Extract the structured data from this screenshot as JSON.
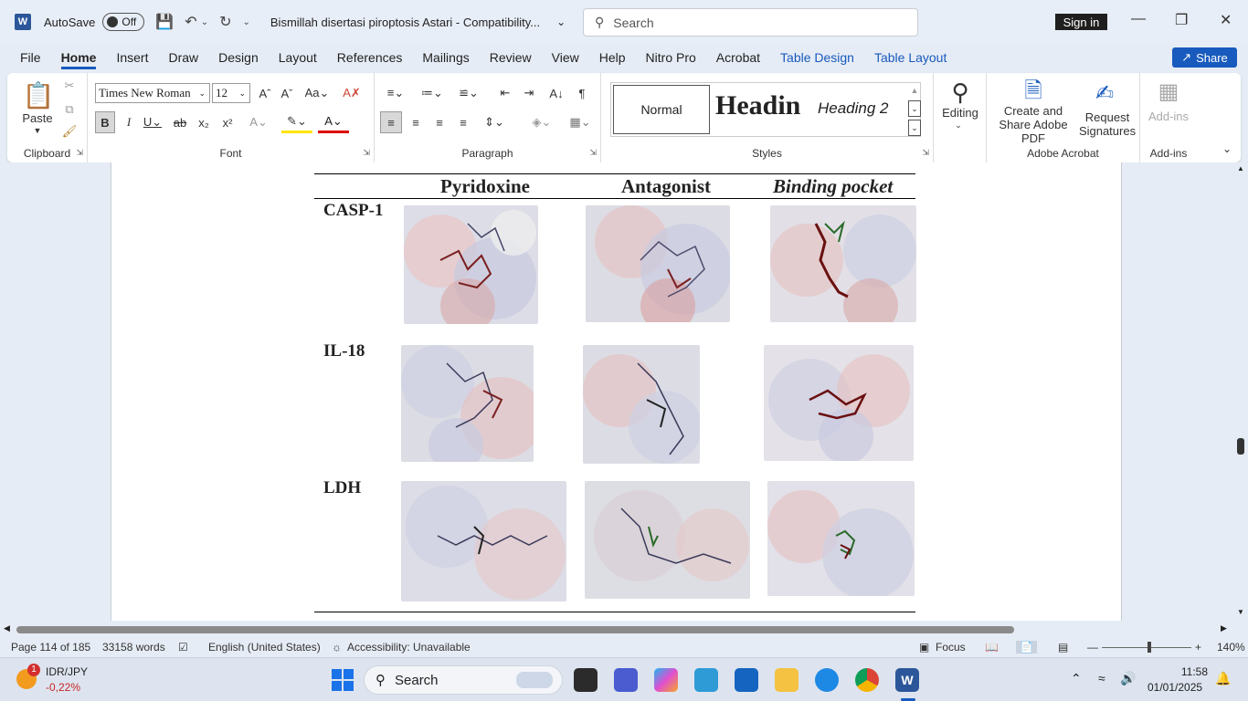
{
  "titlebar": {
    "autosave_label": "AutoSave",
    "autosave_state": "Off",
    "doc_title": "Bismillah disertasi piroptosis Astari  -  Compatibility...",
    "search_placeholder": "Search",
    "signin_label": "Sign in"
  },
  "menu": {
    "tabs": [
      "File",
      "Home",
      "Insert",
      "Draw",
      "Design",
      "Layout",
      "References",
      "Mailings",
      "Review",
      "View",
      "Help",
      "Nitro Pro",
      "Acrobat",
      "Table Design",
      "Table Layout"
    ],
    "share_label": "Share"
  },
  "ribbon": {
    "clipboard": {
      "paste_label": "Paste",
      "group_label": "Clipboard"
    },
    "font": {
      "font_name": "Times New Roman",
      "font_size": "12",
      "group_label": "Font"
    },
    "paragraph": {
      "group_label": "Paragraph"
    },
    "styles": {
      "normal": "Normal",
      "heading1": "Headin",
      "heading2": "Heading 2",
      "group_label": "Styles"
    },
    "editing": {
      "label": "Editing"
    },
    "acrobat": {
      "create_share": "Create and Share Adobe PDF",
      "request_signatures": "Request Signatures",
      "group_label": "Adobe Acrobat"
    },
    "addins": {
      "label": "Add-ins",
      "group_label": "Add-ins"
    }
  },
  "document": {
    "columns": [
      "Pyridoxine",
      "Antagonist",
      "Binding pocket"
    ],
    "rows": [
      "CASP-1",
      "IL-18",
      "LDH"
    ]
  },
  "statusbar": {
    "page": "Page 114 of 185",
    "words": "33158 words",
    "language": "English (United States)",
    "accessibility": "Accessibility: Unavailable",
    "focus": "Focus",
    "zoom": "140%"
  },
  "taskbar": {
    "ticker_name": "IDR/JPY",
    "ticker_change": "-0,22%",
    "ticker_badge": "1",
    "search_label": "Search",
    "time": "11:58",
    "date": "01/01/2025"
  }
}
